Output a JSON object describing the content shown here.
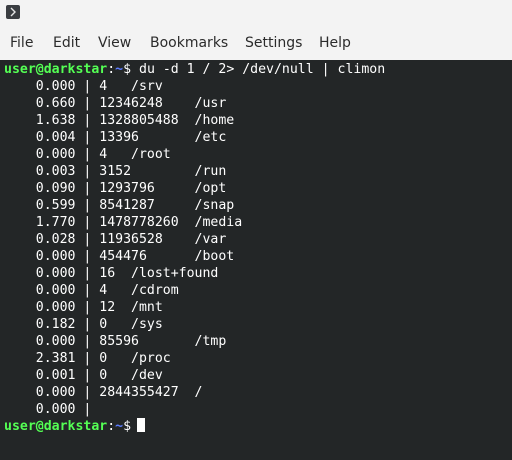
{
  "menu": [
    "File",
    "Edit",
    "View",
    "Bookmarks",
    "Settings",
    "Help"
  ],
  "prompt": {
    "user_host": "user@darkstar",
    "colon": ":",
    "cwd": "~",
    "symbol": "$"
  },
  "command": " du -d 1 / 2> /dev/null | climon",
  "output": [
    "    0.000 | 4   /srv",
    "    0.660 | 12346248    /usr",
    "    1.638 | 1328805488  /home",
    "    0.004 | 13396       /etc",
    "    0.000 | 4   /root",
    "    0.003 | 3152        /run",
    "    0.090 | 1293796     /opt",
    "    0.599 | 8541287     /snap",
    "    1.770 | 1478778260  /media",
    "    0.028 | 11936528    /var",
    "    0.000 | 454476      /boot",
    "    0.000 | 16  /lost+found",
    "    0.000 | 4   /cdrom",
    "    0.000 | 12  /mnt",
    "    0.182 | 0   /sys",
    "    0.000 | 85596       /tmp",
    "    2.381 | 0   /proc",
    "    0.001 | 0   /dev",
    "    0.000 | 2844355427  /",
    "    0.000 |"
  ]
}
